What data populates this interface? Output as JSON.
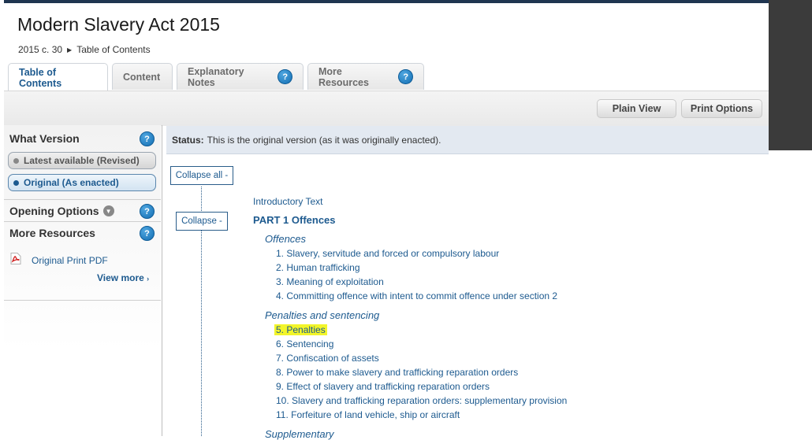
{
  "header": {
    "title": "Modern Slavery Act 2015",
    "breadcrumb": {
      "citation": "2015 c. 30",
      "current": "Table of Contents"
    }
  },
  "tabs": [
    {
      "label": "Table of Contents",
      "active": true
    },
    {
      "label": "Content"
    },
    {
      "label": "Explanatory Notes",
      "help": "?"
    },
    {
      "label": "More Resources",
      "help": "?"
    }
  ],
  "toolbar": {
    "plain_view": "Plain View",
    "print_options": "Print Options"
  },
  "sidebar": {
    "what_version": "What Version",
    "latest": "Latest available (Revised)",
    "original": "Original (As enacted)",
    "opening_options": "Opening Options",
    "more_resources": "More Resources",
    "pdf_link": "Original Print PDF",
    "view_more": "View more",
    "help": "?"
  },
  "status": {
    "label": "Status:",
    "text": "This is the original version (as it was originally enacted)."
  },
  "toc": {
    "collapse_all": "Collapse all -",
    "collapse": "Collapse -",
    "intro": "Introductory Text",
    "part": "PART 1 Offences",
    "groups": [
      {
        "heading": "Offences",
        "items": [
          "1. Slavery, servitude and forced or compulsory labour",
          "2. Human trafficking",
          "3. Meaning of exploitation",
          "4. Committing offence with intent to commit offence under section 2"
        ]
      },
      {
        "heading": "Penalties and sentencing",
        "items": [
          "5. Penalties",
          "6. Sentencing",
          "7. Confiscation of assets",
          "8. Power to make slavery and trafficking reparation orders",
          "9. Effect of slavery and trafficking reparation orders",
          "10. Slavery and trafficking reparation orders: supplementary provision",
          "11. Forfeiture of land vehicle, ship or aircraft"
        ]
      },
      {
        "heading": "Supplementary"
      }
    ]
  },
  "colors": {
    "accent": "#1d5a8f",
    "highlight": "#f2f52a",
    "status_bg": "#e3e9f1"
  }
}
